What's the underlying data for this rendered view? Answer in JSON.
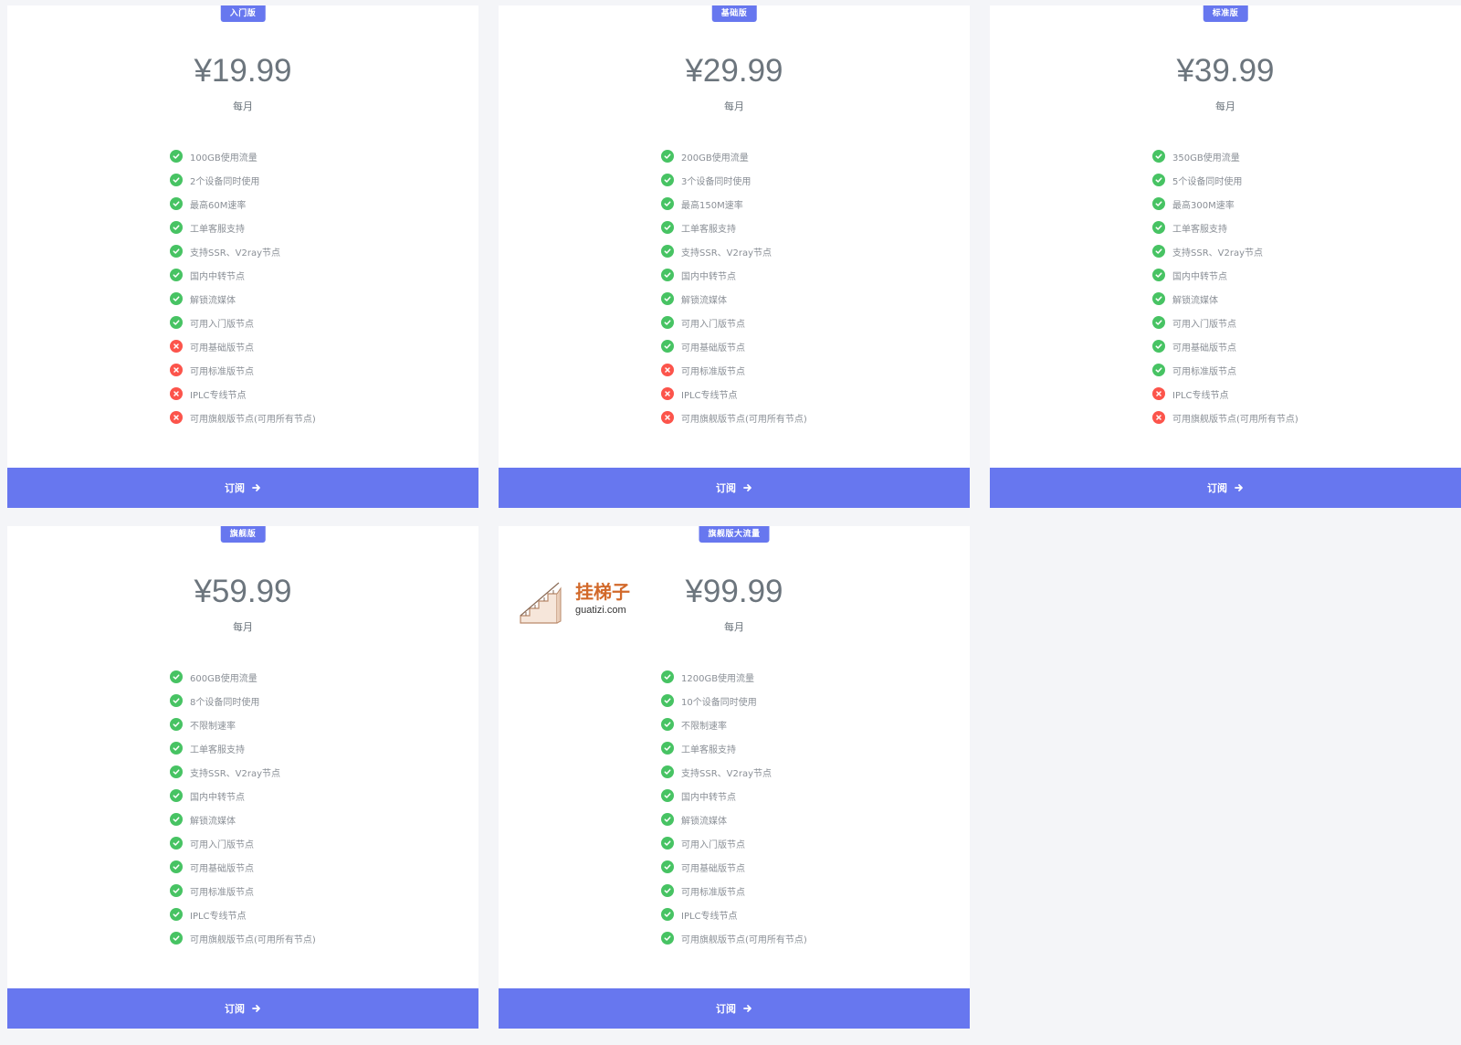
{
  "colors": {
    "primary": "#6777ef",
    "success": "#47c363",
    "danger": "#fc544b",
    "muted": "#6c757d",
    "background": "#f4f5f8"
  },
  "watermark": {
    "name": "挂梯子",
    "domain": "guatizi.com"
  },
  "plans": [
    {
      "badge": "入门版",
      "price": "¥19.99",
      "period": "每月",
      "subscribe_label": "订阅",
      "features": [
        {
          "text": "100GB使用流量",
          "included": true
        },
        {
          "text": "2个设备同时使用",
          "included": true
        },
        {
          "text": "最高60M速率",
          "included": true
        },
        {
          "text": "工单客服支持",
          "included": true
        },
        {
          "text": "支持SSR、V2ray节点",
          "included": true
        },
        {
          "text": "国内中转节点",
          "included": true
        },
        {
          "text": "解锁流媒体",
          "included": true
        },
        {
          "text": "可用入门版节点",
          "included": true
        },
        {
          "text": "可用基础版节点",
          "included": false
        },
        {
          "text": "可用标准版节点",
          "included": false
        },
        {
          "text": "IPLC专线节点",
          "included": false
        },
        {
          "text": "可用旗舰版节点(可用所有节点)",
          "included": false
        }
      ]
    },
    {
      "badge": "基础版",
      "price": "¥29.99",
      "period": "每月",
      "subscribe_label": "订阅",
      "features": [
        {
          "text": "200GB使用流量",
          "included": true
        },
        {
          "text": "3个设备同时使用",
          "included": true
        },
        {
          "text": "最高150M速率",
          "included": true
        },
        {
          "text": "工单客服支持",
          "included": true
        },
        {
          "text": "支持SSR、V2ray节点",
          "included": true
        },
        {
          "text": "国内中转节点",
          "included": true
        },
        {
          "text": "解锁流媒体",
          "included": true
        },
        {
          "text": "可用入门版节点",
          "included": true
        },
        {
          "text": "可用基础版节点",
          "included": true
        },
        {
          "text": "可用标准版节点",
          "included": false
        },
        {
          "text": "IPLC专线节点",
          "included": false
        },
        {
          "text": "可用旗舰版节点(可用所有节点)",
          "included": false
        }
      ]
    },
    {
      "badge": "标准版",
      "price": "¥39.99",
      "period": "每月",
      "subscribe_label": "订阅",
      "features": [
        {
          "text": "350GB使用流量",
          "included": true
        },
        {
          "text": "5个设备同时使用",
          "included": true
        },
        {
          "text": "最高300M速率",
          "included": true
        },
        {
          "text": "工单客服支持",
          "included": true
        },
        {
          "text": "支持SSR、V2ray节点",
          "included": true
        },
        {
          "text": "国内中转节点",
          "included": true
        },
        {
          "text": "解锁流媒体",
          "included": true
        },
        {
          "text": "可用入门版节点",
          "included": true
        },
        {
          "text": "可用基础版节点",
          "included": true
        },
        {
          "text": "可用标准版节点",
          "included": true
        },
        {
          "text": "IPLC专线节点",
          "included": false
        },
        {
          "text": "可用旗舰版节点(可用所有节点)",
          "included": false
        }
      ]
    },
    {
      "badge": "旗舰版",
      "price": "¥59.99",
      "period": "每月",
      "subscribe_label": "订阅",
      "features": [
        {
          "text": "600GB使用流量",
          "included": true
        },
        {
          "text": "8个设备同时使用",
          "included": true
        },
        {
          "text": "不限制速率",
          "included": true
        },
        {
          "text": "工单客服支持",
          "included": true
        },
        {
          "text": "支持SSR、V2ray节点",
          "included": true
        },
        {
          "text": "国内中转节点",
          "included": true
        },
        {
          "text": "解锁流媒体",
          "included": true
        },
        {
          "text": "可用入门版节点",
          "included": true
        },
        {
          "text": "可用基础版节点",
          "included": true
        },
        {
          "text": "可用标准版节点",
          "included": true
        },
        {
          "text": "IPLC专线节点",
          "included": true
        },
        {
          "text": "可用旗舰版节点(可用所有节点)",
          "included": true
        }
      ]
    },
    {
      "badge": "旗舰版大流量",
      "price": "¥99.99",
      "period": "每月",
      "subscribe_label": "订阅",
      "features": [
        {
          "text": "1200GB使用流量",
          "included": true
        },
        {
          "text": "10个设备同时使用",
          "included": true
        },
        {
          "text": "不限制速率",
          "included": true
        },
        {
          "text": "工单客服支持",
          "included": true
        },
        {
          "text": "支持SSR、V2ray节点",
          "included": true
        },
        {
          "text": "国内中转节点",
          "included": true
        },
        {
          "text": "解锁流媒体",
          "included": true
        },
        {
          "text": "可用入门版节点",
          "included": true
        },
        {
          "text": "可用基础版节点",
          "included": true
        },
        {
          "text": "可用标准版节点",
          "included": true
        },
        {
          "text": "IPLC专线节点",
          "included": true
        },
        {
          "text": "可用旗舰版节点(可用所有节点)",
          "included": true
        }
      ]
    }
  ]
}
